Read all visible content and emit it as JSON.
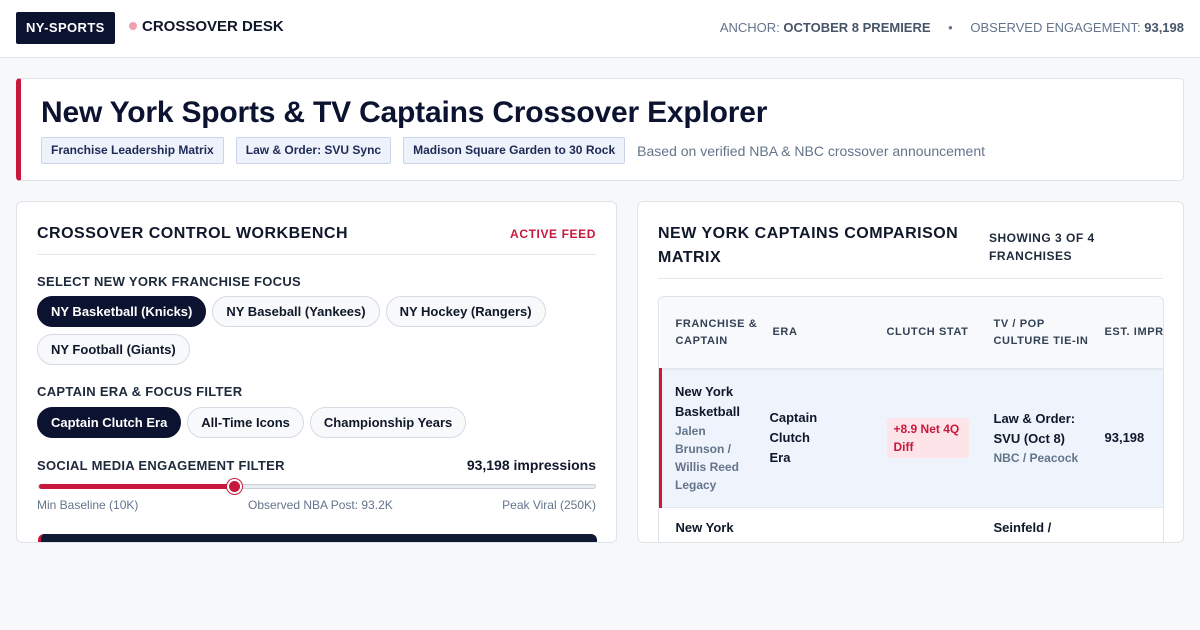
{
  "topbar": {
    "brand": "NY-SPORTS",
    "desk": "CROSSOVER DESK",
    "anchor_label": "ANCHOR:",
    "anchor_value": "OCTOBER 8 PREMIERE",
    "separator": "•",
    "engagement_label": "OBSERVED ENGAGEMENT:",
    "engagement_value": "93,198"
  },
  "hero": {
    "title": "New York Sports & TV Captains Crossover Explorer",
    "tags": [
      "Franchise Leadership Matrix",
      "Law & Order: SVU Sync",
      "Madison Square Garden to 30 Rock"
    ],
    "note": "Based on verified NBA & NBC crossover announcement"
  },
  "workbench": {
    "title": "CROSSOVER CONTROL WORKBENCH",
    "status": "ACTIVE FEED",
    "franchise_label": "SELECT NEW YORK FRANCHISE FOCUS",
    "franchises": [
      "NY Basketball (Knicks)",
      "NY Baseball (Yankees)",
      "NY Hockey (Rangers)",
      "NY Football (Giants)"
    ],
    "era_label": "CAPTAIN ERA & FOCUS FILTER",
    "eras": [
      "Captain Clutch Era",
      "All-Time Icons",
      "Championship Years"
    ],
    "engagement_label": "SOCIAL MEDIA ENGAGEMENT FILTER",
    "engagement_value": "93,198 impressions",
    "slider_fraction": 0.35,
    "slider_min_label": "Min Baseline (10K)",
    "slider_mid_label": "Observed NBA Post: 93.2K",
    "slider_max_label": "Peak Viral (250K)"
  },
  "matrix": {
    "title": "NEW YORK CAPTAINS COMPARISON MATRIX",
    "showing": "SHOWING 3 OF 4 FRANCHISES",
    "columns": [
      "FRANCHISE & CAPTAIN",
      "ERA",
      "CLUTCH STAT",
      "TV / POP CULTURE TIE-IN",
      "EST. IMPRESSIONS"
    ],
    "rows": [
      {
        "franchise": "New York Basketball",
        "captain": "Jalen Brunson / Willis Reed Legacy",
        "era": "Captain Clutch Era",
        "stat": "+8.9 Net 4Q Diff",
        "tv": "Law & Order: SVU (Oct 8)",
        "network": "NBC / Peacock",
        "impressions": "93,198"
      },
      {
        "franchise": "New York",
        "tv": "Seinfeld /"
      }
    ]
  },
  "colors": {
    "accent": "#c8193c",
    "navy": "#0b1330"
  }
}
